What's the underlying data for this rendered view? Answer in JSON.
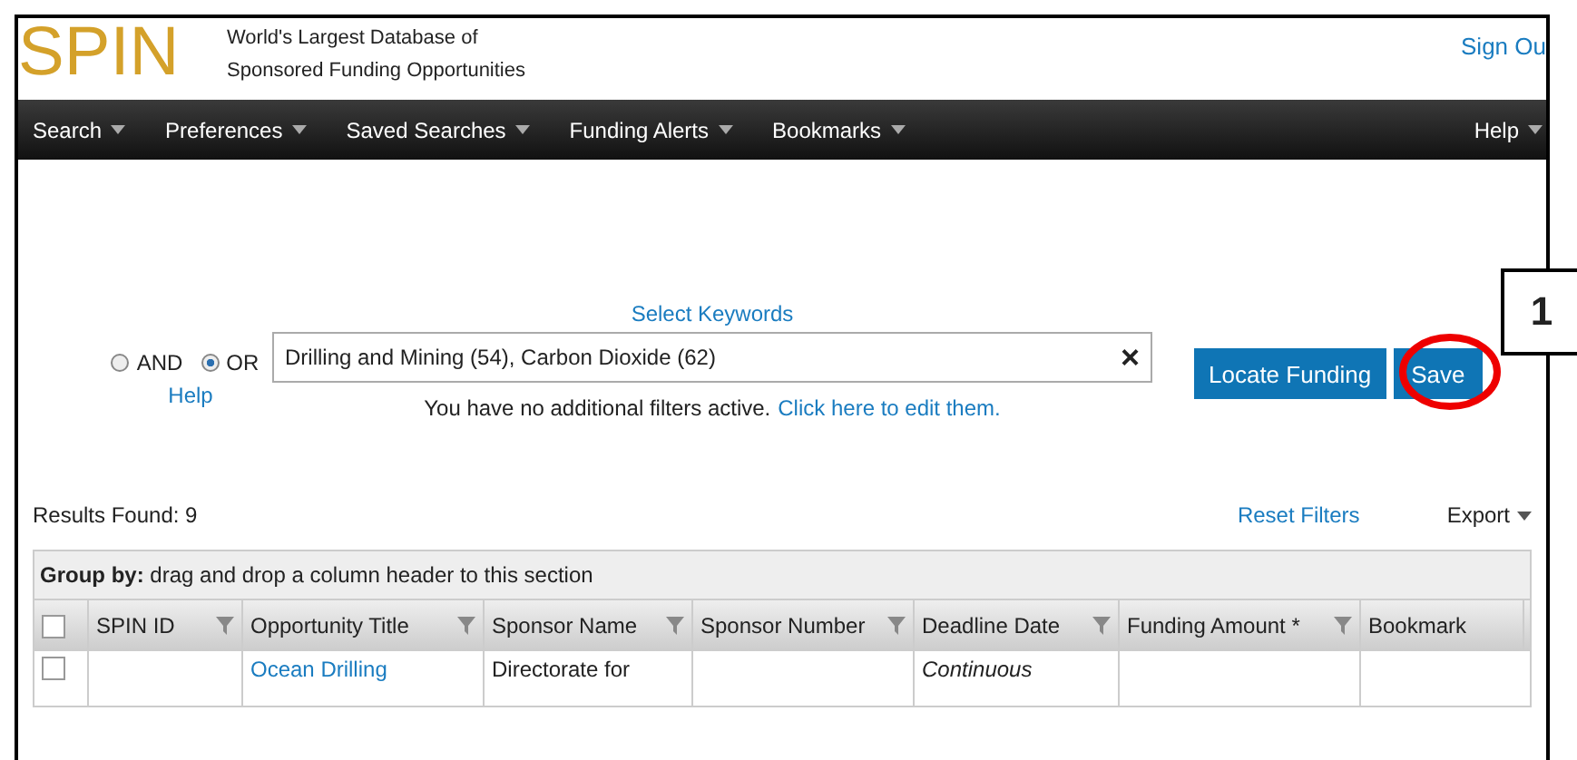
{
  "header": {
    "logo": "SPIN",
    "tagline": [
      "World's Largest Database of",
      "Sponsored Funding Opportunities"
    ],
    "sign_out": "Sign Ou"
  },
  "nav": {
    "items": [
      "Search",
      "Preferences",
      "Saved Searches",
      "Funding Alerts",
      "Bookmarks"
    ],
    "help": "Help"
  },
  "search": {
    "select_keywords": "Select Keywords",
    "operators": [
      {
        "label": "AND",
        "selected": false
      },
      {
        "label": "OR",
        "selected": true
      }
    ],
    "help": "Help",
    "value": "Drilling and Mining (54), Carbon Dioxide (62)",
    "clear": "×",
    "locate": "Locate Funding",
    "save": "Save",
    "filters_text": "You have no additional filters active.",
    "filters_link": "Click here to edit them."
  },
  "callout": {
    "label": "1"
  },
  "results": {
    "found": "Results Found: 9",
    "reset": "Reset Filters",
    "export": "Export",
    "group_by": "**Group by:** drag and drop a column header to this section",
    "select_all": {
      "checked": false
    },
    "columns": [
      {
        "label": "SPIN ID",
        "filter": true
      },
      {
        "label": "Opportunity Title",
        "filter": true
      },
      {
        "label": "Sponsor Name",
        "filter": true
      },
      {
        "label": "Sponsor Number",
        "filter": true
      },
      {
        "label": "Deadline Date",
        "filter": true
      },
      {
        "label": "Funding Amount *",
        "filter": true
      },
      {
        "label": "Bookmark",
        "filter": false
      }
    ],
    "row": {
      "checked": false,
      "title": "Ocean Drilling",
      "sponsor": "Directorate for",
      "deadline": "Continuous"
    }
  }
}
